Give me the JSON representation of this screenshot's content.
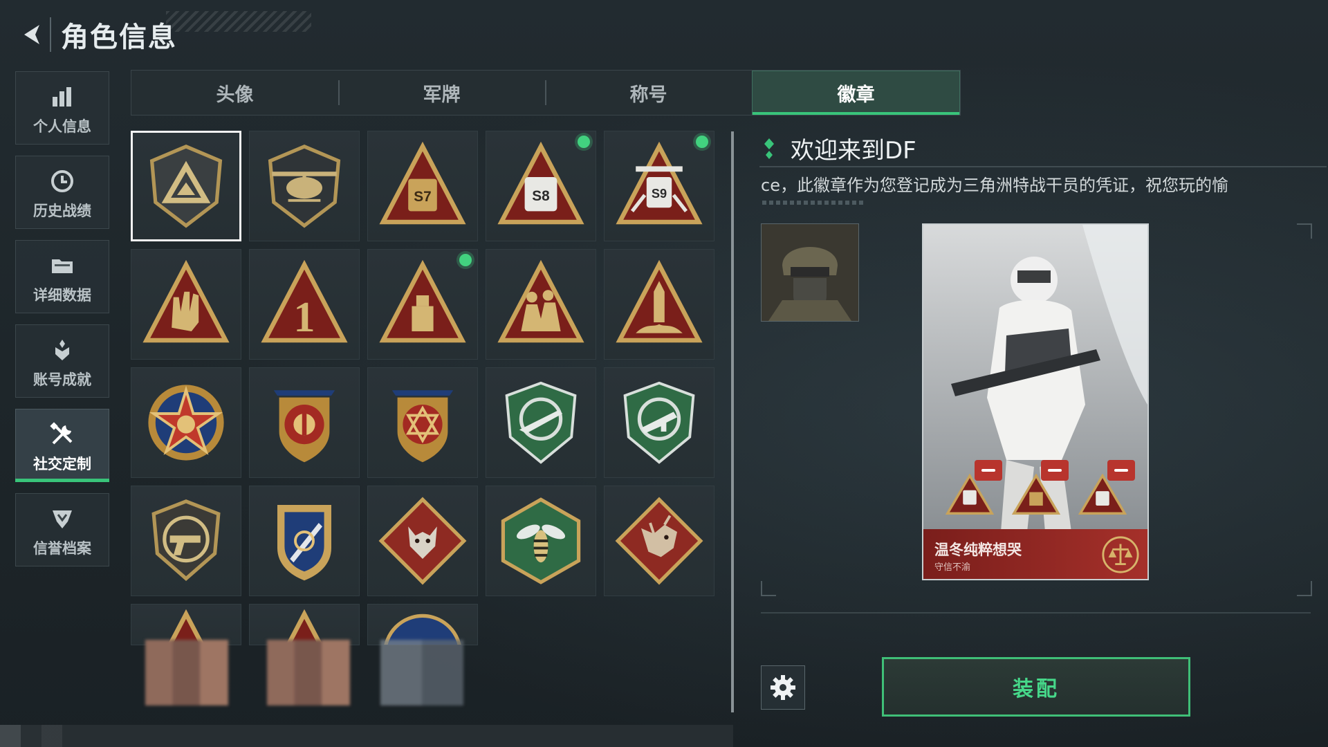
{
  "header": {
    "title": "角色信息"
  },
  "sidebar": {
    "items": [
      {
        "label": "个人信息",
        "icon": "bar-chart-icon"
      },
      {
        "label": "历史战绩",
        "icon": "clock-icon"
      },
      {
        "label": "详细数据",
        "icon": "folder-icon"
      },
      {
        "label": "账号成就",
        "icon": "trophy-icon"
      },
      {
        "label": "社交定制",
        "icon": "tools-icon",
        "active": true
      },
      {
        "label": "信誉档案",
        "icon": "shield-check-icon"
      }
    ]
  },
  "tabs": [
    {
      "label": "头像"
    },
    {
      "label": "军牌"
    },
    {
      "label": "称号"
    },
    {
      "label": "徽章",
      "active": true
    }
  ],
  "badges": [
    {
      "row": 0,
      "col": 0,
      "icon": "delta-shield-badge",
      "selected": true,
      "new": false
    },
    {
      "row": 0,
      "col": 1,
      "icon": "helicopter-badge",
      "new": false
    },
    {
      "row": 0,
      "col": 2,
      "icon": "s7-triangle-badge",
      "text": "S7",
      "new": false
    },
    {
      "row": 0,
      "col": 3,
      "icon": "s8-triangle-badge",
      "text": "S8",
      "new": true
    },
    {
      "row": 0,
      "col": 4,
      "icon": "s9-triangle-badge",
      "text": "S9",
      "new": true
    },
    {
      "row": 1,
      "col": 0,
      "icon": "rock-hand-badge",
      "new": false
    },
    {
      "row": 1,
      "col": 1,
      "icon": "number-one-badge",
      "text": "1",
      "new": false
    },
    {
      "row": 1,
      "col": 2,
      "icon": "usb-triangle-badge",
      "new": true
    },
    {
      "row": 1,
      "col": 3,
      "icon": "soldiers-badge",
      "new": false
    },
    {
      "row": 1,
      "col": 4,
      "icon": "rocket-badge",
      "new": false
    },
    {
      "row": 2,
      "col": 0,
      "icon": "star-wreath-badge",
      "new": false
    },
    {
      "row": 2,
      "col": 1,
      "icon": "crest-shield-badge",
      "new": false
    },
    {
      "row": 2,
      "col": 2,
      "icon": "hexagram-crest-badge",
      "new": false
    },
    {
      "row": 2,
      "col": 3,
      "icon": "green-rifle-badge",
      "new": false
    },
    {
      "row": 2,
      "col": 4,
      "icon": "green-smg-badge",
      "new": false
    },
    {
      "row": 3,
      "col": 0,
      "icon": "pistol-shield-badge",
      "new": false
    },
    {
      "row": 3,
      "col": 1,
      "icon": "knife-crest-badge",
      "new": false
    },
    {
      "row": 3,
      "col": 2,
      "icon": "wolf-diamond-badge",
      "new": false
    },
    {
      "row": 3,
      "col": 3,
      "icon": "wasp-hexagon-badge",
      "new": false
    },
    {
      "row": 3,
      "col": 4,
      "icon": "dragon-diamond-badge",
      "new": false
    }
  ],
  "detail": {
    "title": "欢迎来到DF",
    "description": "ce，此徽章作为您登记成为三角洲特战干员的凭证，祝您玩的愉",
    "card_name": "温冬纯粹想哭",
    "card_subtitle": "守信不渝",
    "equip_label": "装配"
  },
  "colors": {
    "accent": "#39c47a",
    "badge_gold": "#c9a35a",
    "badge_red": "#8e2a22",
    "badge_green": "#2f6b45"
  }
}
